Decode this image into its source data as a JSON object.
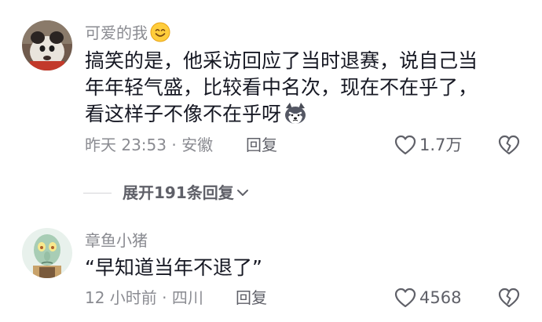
{
  "comments": [
    {
      "username": "可爱的我",
      "username_emoji": "smile-emoji",
      "lines": [
        "搞笑的是，他采访回应了当时退赛，说自己当",
        "年年轻气盛，比较看中名次，现在不在乎了，",
        "看这样子不像不在乎呀"
      ],
      "text_emoji": "husky-dog-emoji",
      "meta": "昨天 23:53 · 安徽",
      "reply_label": "回复",
      "likes": "1.7万"
    },
    {
      "username": "章鱼小猪",
      "lines": [
        "“早知道当年不退了”"
      ],
      "meta": "12 小时前 · 四川",
      "reply_label": "回复",
      "likes": "4568"
    }
  ],
  "expand_replies_label": "展开191条回复",
  "colors": {
    "text": "#161823",
    "secondary": "#8a8b91",
    "action": "#5f6068"
  }
}
